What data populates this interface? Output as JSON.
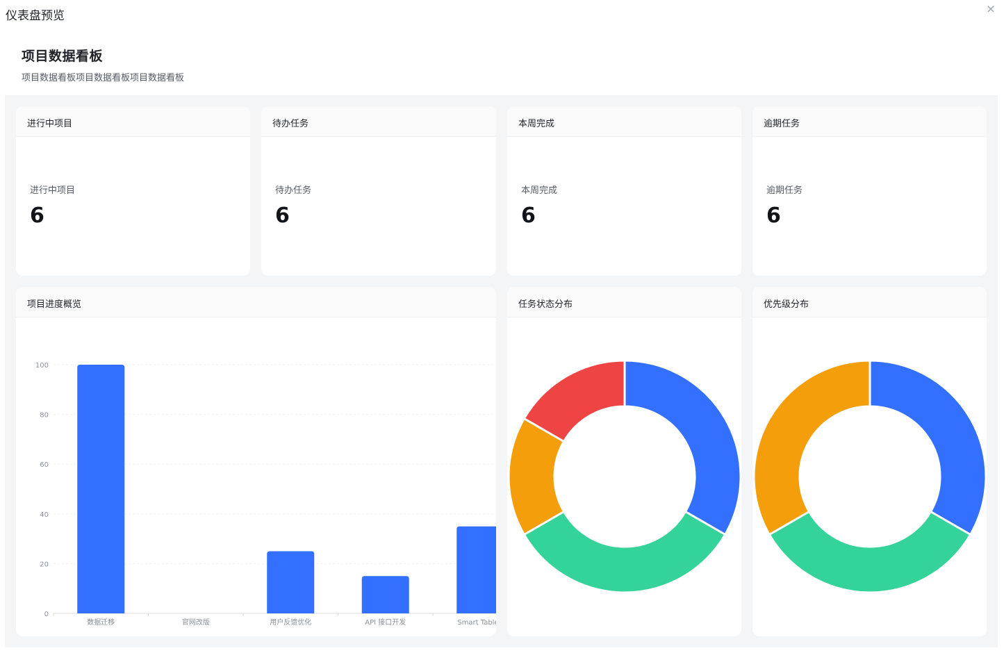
{
  "modal": {
    "title": "仪表盘预览",
    "close_icon": "×"
  },
  "dashboard": {
    "title": "项目数据看板",
    "subtitle": "项目数据看板项目数据看板项目数据看板"
  },
  "stats": [
    {
      "header": "进行中项目",
      "label": "进行中项目",
      "value": "6"
    },
    {
      "header": "待办任务",
      "label": "待办任务",
      "value": "6"
    },
    {
      "header": "本周完成",
      "label": "本周完成",
      "value": "6"
    },
    {
      "header": "逾期任务",
      "label": "逾期任务",
      "value": "6"
    }
  ],
  "colors": {
    "blue": "#3370ff",
    "green": "#34d399",
    "orange": "#f59e0b",
    "red": "#ef4444"
  },
  "charts": {
    "progress_title": "项目进度概览",
    "status_title": "任务状态分布",
    "priority_title": "优先级分布"
  },
  "chart_data": [
    {
      "type": "bar",
      "title": "项目进度概览",
      "categories": [
        "数据迁移",
        "官网改版",
        "用户反馈优化",
        "API 接口开发",
        "Smart Table :"
      ],
      "values": [
        100,
        0,
        25,
        15,
        35
      ],
      "ylim": [
        0,
        100
      ],
      "yticks": [
        0,
        20,
        40,
        60,
        80,
        100
      ],
      "grid": true,
      "color": "#3370ff"
    },
    {
      "type": "pie",
      "title": "任务状态分布",
      "values": [
        2,
        2,
        1,
        1
      ],
      "colors": [
        "#3370ff",
        "#34d399",
        "#f59e0b",
        "#ef4444"
      ]
    },
    {
      "type": "pie",
      "title": "优先级分布",
      "values": [
        2,
        2,
        2
      ],
      "colors": [
        "#3370ff",
        "#34d399",
        "#f59e0b"
      ]
    }
  ]
}
